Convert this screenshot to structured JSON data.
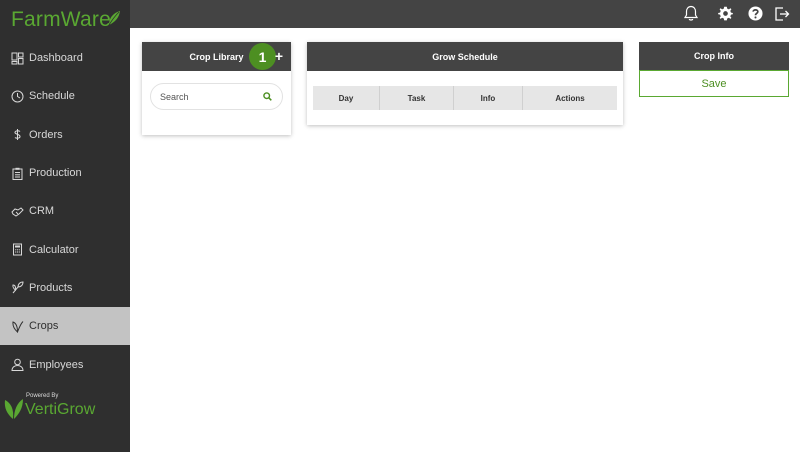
{
  "brand": {
    "name": "FarmWare",
    "powered_by": "Powered By",
    "powered_brand": "VertiGrow"
  },
  "colors": {
    "accent": "#5aa832",
    "sidebar": "#2f2f2f",
    "topbar": "#444444",
    "active_nav": "#c3c3c3"
  },
  "sidebar": {
    "items": [
      {
        "label": "Dashboard",
        "icon": "dashboard-icon",
        "active": false
      },
      {
        "label": "Schedule",
        "icon": "clock-icon",
        "active": false
      },
      {
        "label": "Orders",
        "icon": "dollar-icon",
        "active": false
      },
      {
        "label": "Production",
        "icon": "clipboard-icon",
        "active": false
      },
      {
        "label": "CRM",
        "icon": "handshake-icon",
        "active": false
      },
      {
        "label": "Calculator",
        "icon": "calculator-icon",
        "active": false
      },
      {
        "label": "Products",
        "icon": "sprout-icon",
        "active": false
      },
      {
        "label": "Crops",
        "icon": "leaf-icon",
        "active": true
      },
      {
        "label": "Employees",
        "icon": "person-icon",
        "active": false
      }
    ]
  },
  "topbar": {
    "icons": [
      "bell-icon",
      "gear-icon",
      "help-icon",
      "logout-icon"
    ]
  },
  "crop_library": {
    "title": "Crop Library",
    "badge": "1",
    "add": "+",
    "search_placeholder": "Search"
  },
  "grow_schedule": {
    "title": "Grow Schedule",
    "columns": [
      "Day",
      "Task",
      "Info",
      "Actions"
    ]
  },
  "crop_info": {
    "title": "Crop Info",
    "save_label": "Save"
  }
}
